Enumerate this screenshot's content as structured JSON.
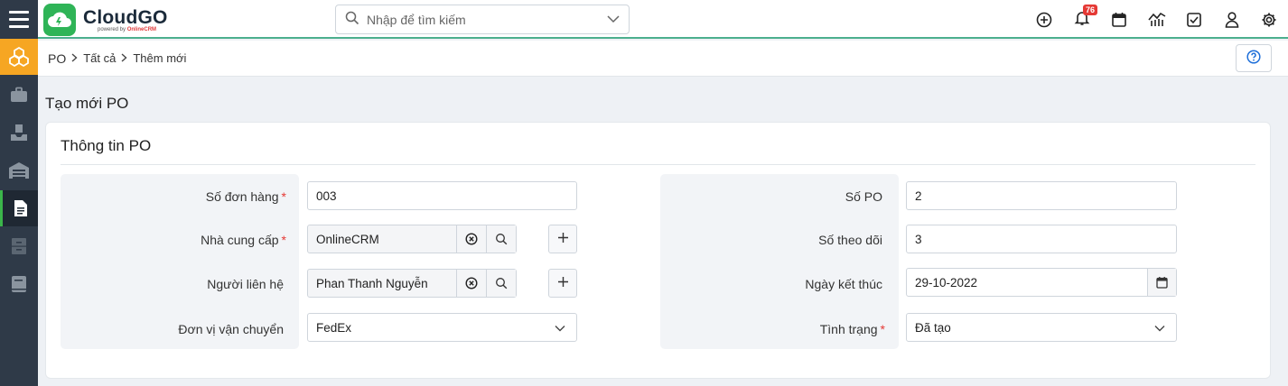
{
  "app": {
    "brand": "CloudGO",
    "brand_sub_prefix": "powered by ",
    "brand_sub_online": "Online",
    "brand_sub_crm": "CRM"
  },
  "search": {
    "placeholder": "Nhập để tìm kiếm"
  },
  "toolbar": {
    "notification_count": "76",
    "icons": [
      "plus-circle-icon",
      "bell-icon",
      "calendar-icon",
      "chart-icon",
      "checkbox-icon",
      "user-icon",
      "gear-icon"
    ]
  },
  "sidebar": {
    "icons": [
      "menu-icon",
      "modules-icon",
      "briefcase-icon",
      "inbox-icon",
      "warehouse-icon",
      "document-icon",
      "archive-icon",
      "book-icon"
    ]
  },
  "breadcrumb": {
    "items": [
      "PO",
      "Tất cả",
      "Thêm mới"
    ]
  },
  "page": {
    "title": "Tạo mới PO"
  },
  "section": {
    "title": "Thông tin PO"
  },
  "form": {
    "left": [
      {
        "label": "Số đơn hàng",
        "required": "*",
        "value": "003"
      },
      {
        "label": "Nhà cung cấp",
        "required": "*",
        "value": "OnlineCRM"
      },
      {
        "label": "Người liên hệ",
        "required": "",
        "value": "Phan Thanh Nguyễn"
      },
      {
        "label": "Đơn vị vận chuyển",
        "required": "",
        "value": "FedEx"
      }
    ],
    "right": [
      {
        "label": "Số PO",
        "required": "",
        "value": "2"
      },
      {
        "label": "Số theo dõi",
        "required": "",
        "value": "3"
      },
      {
        "label": "Ngày kết thúc",
        "required": "",
        "value": "29-10-2022"
      },
      {
        "label": "Tình trạng",
        "required": "*",
        "value": "Đã tạo"
      }
    ]
  },
  "colors": {
    "accent": "#2fb457",
    "sidebar": "#2f3a48",
    "sidebar_active": "#f6a623",
    "badge": "#e53935",
    "required": "#e53935"
  }
}
